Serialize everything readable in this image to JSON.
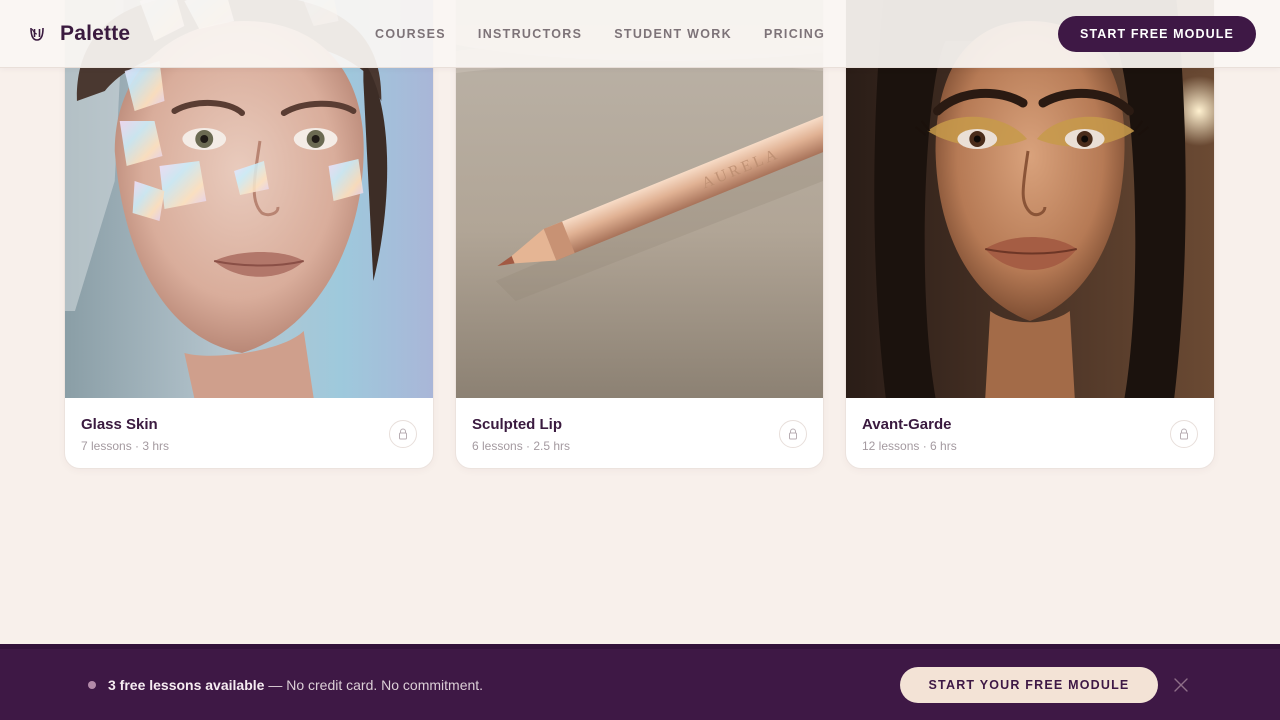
{
  "header": {
    "brand_name": "Palette",
    "brand_icon": "palette-logo-icon",
    "nav": [
      "COURSES",
      "INSTRUCTORS",
      "STUDENT WORK",
      "PRICING"
    ],
    "cta_label": "START FREE MODULE"
  },
  "courses": [
    {
      "title": "Glass Skin",
      "meta": "7 lessons · 3 hrs",
      "icon": "lock-icon"
    },
    {
      "title": "Sculpted Lip",
      "meta": "6 lessons · 2.5 hrs",
      "icon": "lock-icon"
    },
    {
      "title": "Avant-Garde",
      "meta": "12 lessons · 6 hrs",
      "icon": "lock-icon"
    }
  ],
  "banner": {
    "highlight": "3 free lessons available",
    "rest": " — No credit card. No commitment.",
    "cta_label": "START YOUR FREE MODULE",
    "close_icon": "close-icon"
  },
  "colors": {
    "brand_plum": "#3e1845",
    "page_bg": "#f8f0eb",
    "banner_cta_bg": "#f3e3d6"
  }
}
